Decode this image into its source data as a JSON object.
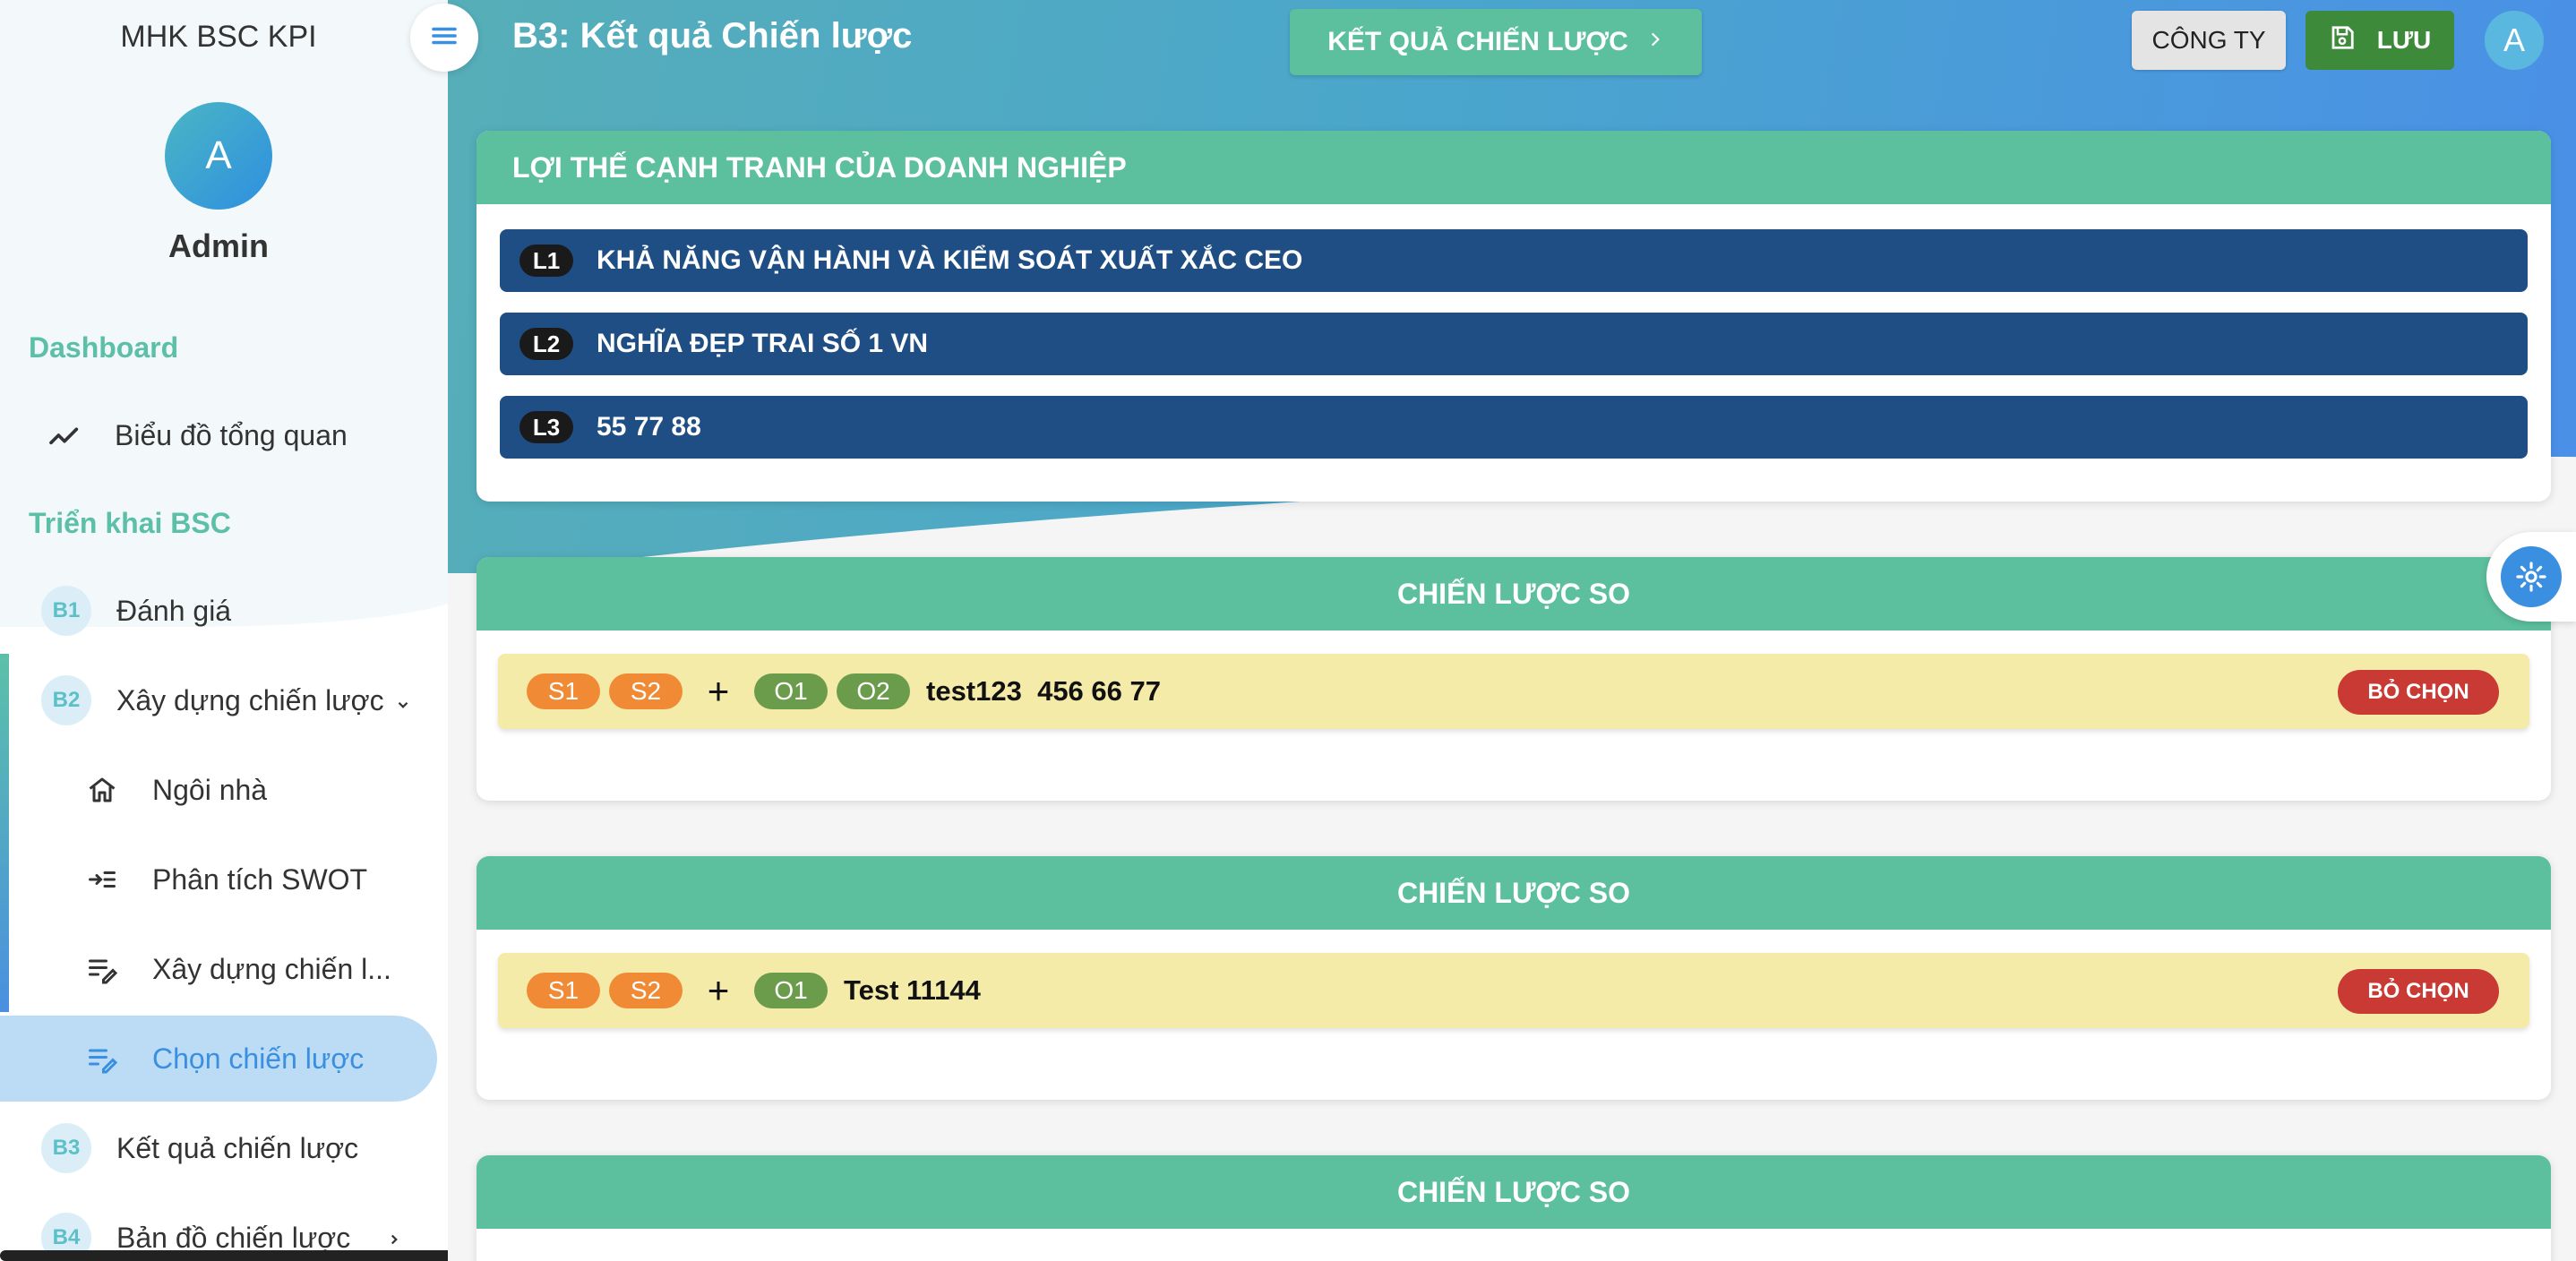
{
  "app": {
    "brand": "MHK BSC KPI"
  },
  "user": {
    "avatar_letter": "A",
    "name": "Admin"
  },
  "sidebar": {
    "section_dashboard": "Dashboard",
    "overview_chart": "Biểu đồ tổng quan",
    "section_bsc": "Triển khai BSC",
    "steps": [
      {
        "badge": "B1",
        "label": "Đánh giá"
      },
      {
        "badge": "B2",
        "label": "Xây dựng chiến lược"
      },
      {
        "badge": "B3",
        "label": "Kết quả chiến lược"
      },
      {
        "badge": "B4",
        "label": "Bản đồ chiến lược"
      }
    ],
    "sub_items": [
      {
        "label": "Ngôi nhà",
        "icon": "home-icon"
      },
      {
        "label": "Phân tích SWOT",
        "icon": "indent-icon"
      },
      {
        "label": "Xây dựng chiến l...",
        "icon": "edit-list-icon"
      },
      {
        "label": "Chọn chiến lược",
        "icon": "edit-list-icon",
        "active": true
      }
    ]
  },
  "header": {
    "title": "B3: Kết quả Chiến lược",
    "result_button": "KẾT QUẢ CHIẾN LƯỢC",
    "company_button": "CÔNG TY",
    "save_button": "LƯU",
    "avatar_letter": "A"
  },
  "advantages": {
    "title": "LỢI THẾ CẠNH TRANH CỦA DOANH NGHIỆP",
    "items": [
      {
        "tag": "L1",
        "text": "KHẢ NĂNG VẬN HÀNH VÀ KIỂM SOÁT XUẤT XẮC CEO"
      },
      {
        "tag": "L2",
        "text": "NGHĨA ĐẸP TRAI SỐ 1 VN"
      },
      {
        "tag": "L3",
        "text": "55 77 88"
      }
    ]
  },
  "strategies": [
    {
      "title": "CHIẾN LƯỢC SO",
      "s_tags": [
        "S1",
        "S2"
      ],
      "o_tags": [
        "O1",
        "O2"
      ],
      "plus": "+",
      "text": "test123  456 66 77",
      "deselect": "BỎ CHỌN"
    },
    {
      "title": "CHIẾN LƯỢC SO",
      "s_tags": [
        "S1",
        "S2"
      ],
      "o_tags": [
        "O1"
      ],
      "plus": "+",
      "text": "Test 11144",
      "deselect": "BỎ CHỌN"
    },
    {
      "title": "CHIẾN LƯỢC SO"
    }
  ],
  "colors": {
    "accent_green": "#5cbf9e",
    "advantage_blue": "#1f4e85",
    "strength_orange": "#f08a34",
    "opportunity_green": "#6b9c4c",
    "deselect_red": "#c83a33",
    "save_green": "#3d8a3a"
  }
}
